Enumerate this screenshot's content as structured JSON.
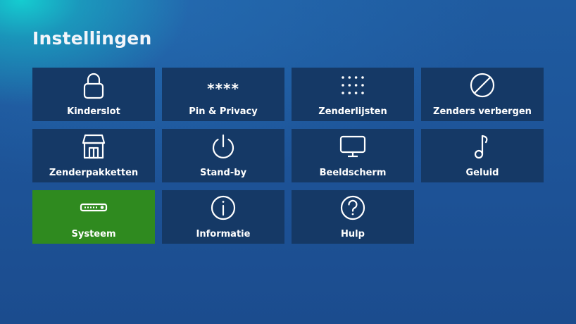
{
  "page": {
    "title": "Instellingen"
  },
  "tiles": [
    {
      "label": "Kinderslot",
      "icon": "lock-icon"
    },
    {
      "label": "Pin & Privacy",
      "icon": "pin-asterisks-icon",
      "glyph": "****"
    },
    {
      "label": "Zenderlijsten",
      "icon": "dot-grid-icon"
    },
    {
      "label": "Zenders verbergen",
      "icon": "prohibited-icon"
    },
    {
      "label": "Zenderpakketten",
      "icon": "storefront-icon"
    },
    {
      "label": "Stand-by",
      "icon": "power-icon"
    },
    {
      "label": "Beeldscherm",
      "icon": "monitor-icon"
    },
    {
      "label": "Geluid",
      "icon": "music-note-icon"
    },
    {
      "label": "Systeem",
      "icon": "settop-box-icon",
      "selected": true
    },
    {
      "label": "Informatie",
      "icon": "info-icon"
    },
    {
      "label": "Hulp",
      "icon": "help-icon"
    }
  ],
  "colors": {
    "background": "#1d5296",
    "tile": "#153966",
    "tile_selected": "#2f8a1f",
    "text": "#ffffff"
  }
}
